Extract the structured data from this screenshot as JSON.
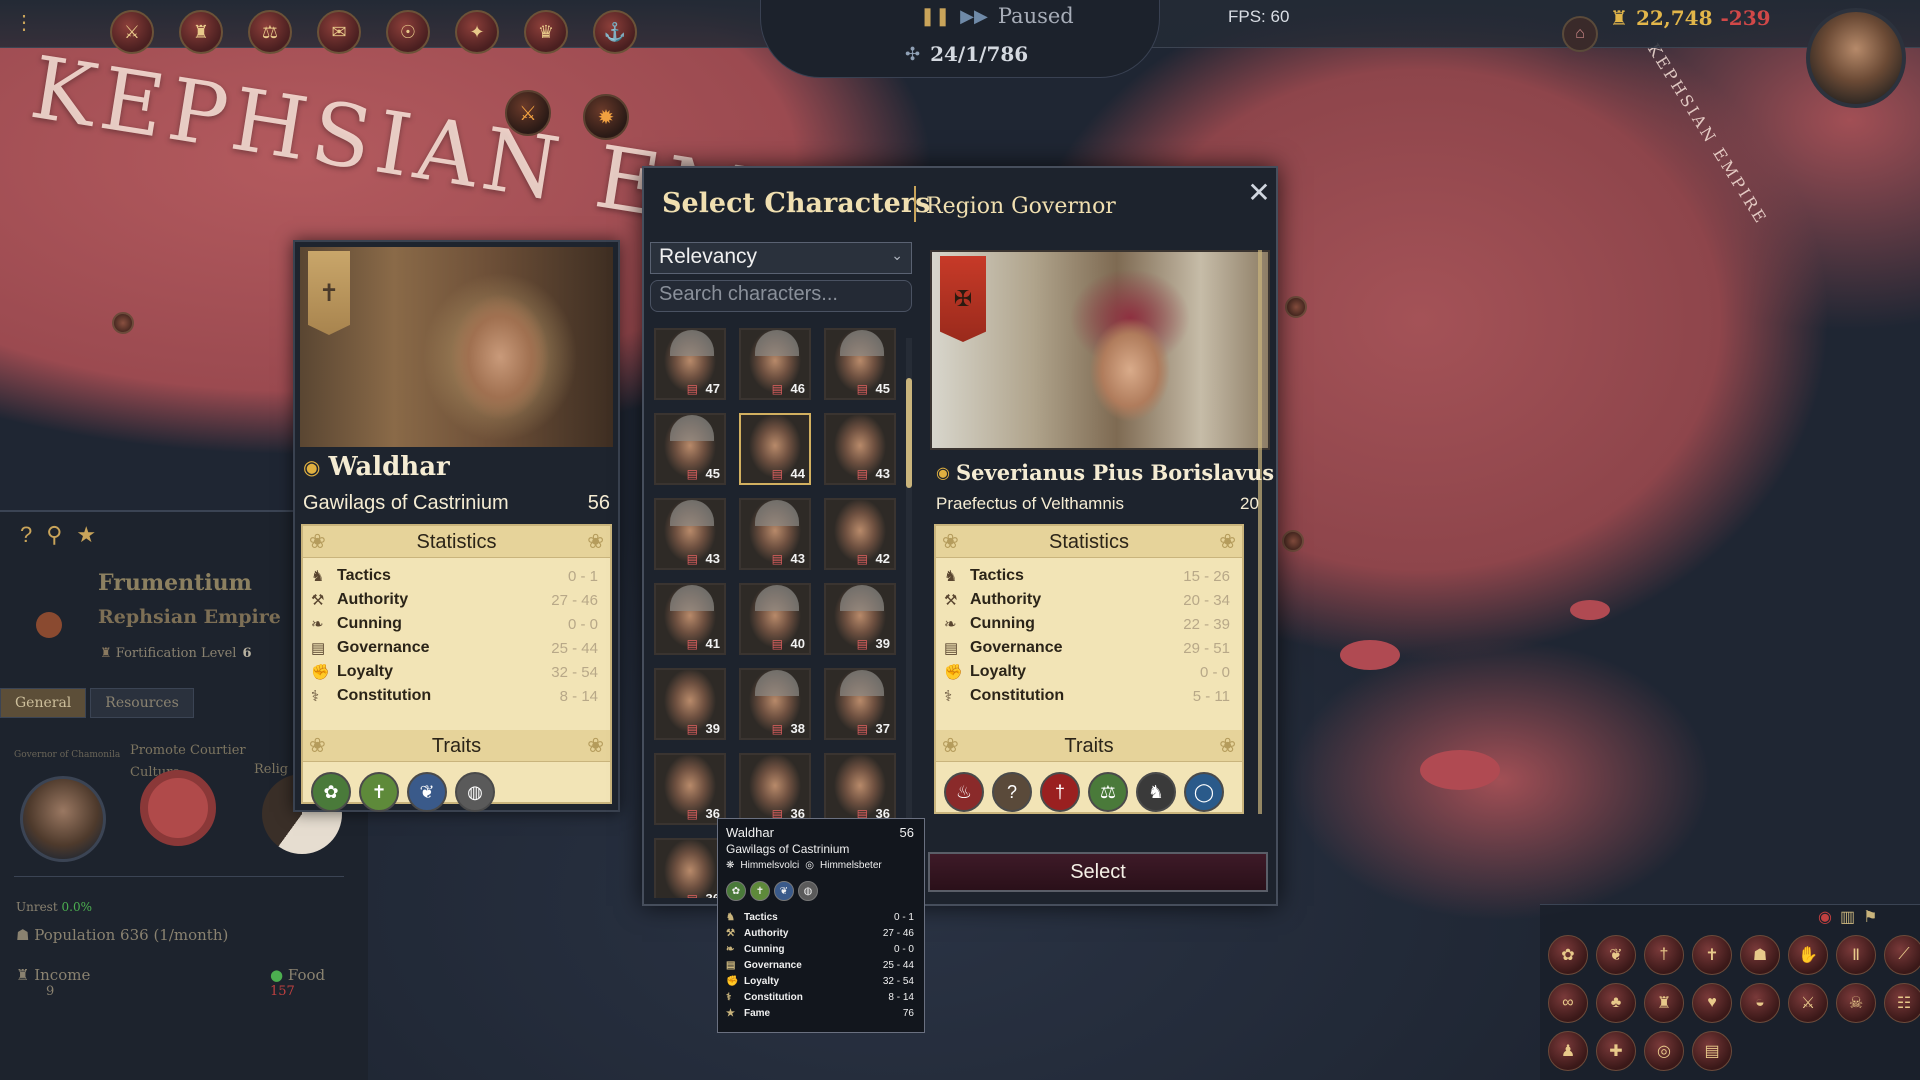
{
  "hud": {
    "paused_label": "Paused",
    "date": "24/1/786",
    "fps": "FPS: 60",
    "treasury": "22,748",
    "treasury_change": "-239"
  },
  "map": {
    "empire_label": "KEPHSIAN EMPIRE",
    "empire_label_small": "KEPHSIAN EMPIRE"
  },
  "region": {
    "name": "Frumentium",
    "empire": "Rephsian Empire",
    "fortification_label": "Fortification Level",
    "fortification_value": "6",
    "tabs": [
      "General",
      "Resources"
    ],
    "governor_label": "Governor of Chamonila",
    "promote_label": "Promote Courtier",
    "culture_label": "Culture",
    "religion_label": "Relig",
    "unrest_label": "Unrest",
    "unrest_value": "0.0%",
    "population_label": "Population",
    "population_value": "636 (1/month)",
    "income_label": "Income",
    "income_value": "9",
    "food_label": "Food",
    "food_value": "157"
  },
  "waldhar_card": {
    "name": "Waldhar",
    "family": "Gawilags of Castrinium",
    "age": "56",
    "statistics_label": "Statistics",
    "traits_label": "Traits",
    "stats": [
      {
        "name": "Tactics",
        "value": "0 - 1",
        "icon": "tactics-icon"
      },
      {
        "name": "Authority",
        "value": "27 - 46",
        "icon": "authority-icon"
      },
      {
        "name": "Cunning",
        "value": "0 - 0",
        "icon": "cunning-icon"
      },
      {
        "name": "Governance",
        "value": "25 - 44",
        "icon": "governance-icon"
      },
      {
        "name": "Loyalty",
        "value": "32 - 54",
        "icon": "loyalty-icon"
      },
      {
        "name": "Constitution",
        "value": "8 - 14",
        "icon": "constitution-icon"
      }
    ],
    "traits": [
      {
        "icon": "wreath-trait-icon",
        "color": "#4a7a3a"
      },
      {
        "icon": "cross-trait-icon",
        "color": "#5e8a3a"
      },
      {
        "icon": "dove-trait-icon",
        "color": "#3a5a8a"
      },
      {
        "icon": "shield-trait-icon",
        "color": "#5a5a5a"
      }
    ]
  },
  "dialog": {
    "title": "Select Characters",
    "subtitle": "Region Governor",
    "sort_value": "Relevancy",
    "search_placeholder": "Search characters...",
    "select_label": "Select",
    "grid": [
      {
        "score": "47"
      },
      {
        "score": "46"
      },
      {
        "score": "45"
      },
      {
        "score": "45"
      },
      {
        "score": "44"
      },
      {
        "score": "43"
      },
      {
        "score": "43"
      },
      {
        "score": "43"
      },
      {
        "score": "42"
      },
      {
        "score": "41"
      },
      {
        "score": "40"
      },
      {
        "score": "39"
      },
      {
        "score": "39"
      },
      {
        "score": "38"
      },
      {
        "score": "37"
      },
      {
        "score": "36"
      },
      {
        "score": "36"
      },
      {
        "score": "36"
      },
      {
        "score": "36"
      },
      {
        "score": ""
      },
      {
        "score": ""
      }
    ]
  },
  "selected_character": {
    "name": "Severianus Pius Borislavus",
    "title": "Praefectus of Velthamnis",
    "age": "20",
    "statistics_label": "Statistics",
    "traits_label": "Traits",
    "stats": [
      {
        "name": "Tactics",
        "value": "15 - 26",
        "icon": "tactics-icon"
      },
      {
        "name": "Authority",
        "value": "20 - 34",
        "icon": "authority-icon"
      },
      {
        "name": "Cunning",
        "value": "22 - 39",
        "icon": "cunning-icon"
      },
      {
        "name": "Governance",
        "value": "29 - 51",
        "icon": "governance-icon"
      },
      {
        "name": "Loyalty",
        "value": "0 - 0",
        "icon": "loyalty-icon"
      },
      {
        "name": "Constitution",
        "value": "5 - 11",
        "icon": "constitution-icon"
      }
    ],
    "traits": [
      {
        "icon": "wine-trait-icon",
        "color": "#8a2a2a"
      },
      {
        "icon": "question-trait-icon",
        "color": "#5a4a3a"
      },
      {
        "icon": "sword-trait-icon",
        "color": "#9a2020"
      },
      {
        "icon": "scales-trait-icon",
        "color": "#4a7a3a"
      },
      {
        "icon": "horse-trait-icon",
        "color": "#3a3a3a"
      },
      {
        "icon": "ring-trait-icon",
        "color": "#2a5a8a"
      }
    ]
  },
  "tooltip": {
    "name": "Waldhar",
    "age": "56",
    "family": "Gawilags of Castrinium",
    "culture_1": "Himmelsvolci",
    "culture_2": "Himmelsbeter",
    "stats": [
      {
        "name": "Tactics",
        "value": "0 - 1"
      },
      {
        "name": "Authority",
        "value": "27 - 46"
      },
      {
        "name": "Cunning",
        "value": "0 - 0"
      },
      {
        "name": "Governance",
        "value": "25 - 44"
      },
      {
        "name": "Loyalty",
        "value": "32 - 54"
      },
      {
        "name": "Constitution",
        "value": "8 - 14"
      },
      {
        "name": "Fame",
        "value": "76"
      }
    ]
  }
}
